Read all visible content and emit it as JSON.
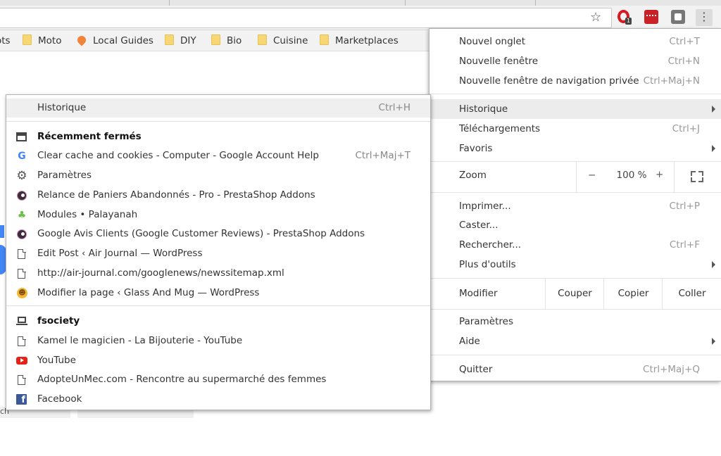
{
  "browser": {
    "toolbar": {
      "opera_badge": "1",
      "menu_glyph": "⋮"
    },
    "bookmarks": [
      {
        "label": "ots",
        "icon": "folder-icon"
      },
      {
        "label": "Moto",
        "icon": "folder-icon"
      },
      {
        "label": "Local Guides",
        "icon": "pin-icon"
      },
      {
        "label": "DIY",
        "icon": "folder-icon"
      },
      {
        "label": "Bio",
        "icon": "folder-icon"
      },
      {
        "label": "Cuisine",
        "icon": "folder-icon"
      },
      {
        "label": "Marketplaces",
        "icon": "folder-icon"
      }
    ],
    "bg_field_text": "ch"
  },
  "history_menu": {
    "header": {
      "label": "Historique",
      "shortcut": "Ctrl+H"
    },
    "recently_closed_title": "Récemment fermés",
    "recent": [
      {
        "label": "Clear cache and cookies - Computer - Google Account Help",
        "shortcut": "Ctrl+Maj+T",
        "icon": "google-icon"
      },
      {
        "label": "Paramètres",
        "icon": "gear-icon"
      },
      {
        "label": "Relance de Paniers Abandonnés - Pro - PrestaShop Addons",
        "icon": "prestashop-icon"
      },
      {
        "label": "Modules • Palayanah",
        "icon": "leaf-icon"
      },
      {
        "label": "Google Avis Clients (Google Customer Reviews) - PrestaShop Addons",
        "icon": "prestashop-icon"
      },
      {
        "label": "Edit Post ‹ Air Journal — WordPress",
        "icon": "file-icon"
      },
      {
        "label": "http://air-journal.com/googlenews/newssitemap.xml",
        "icon": "file-icon"
      },
      {
        "label": "Modifier la page ‹ Glass And Mug — WordPress",
        "icon": "smiley-icon"
      }
    ],
    "device_title": "fsociety",
    "device_tabs": [
      {
        "label": "Kamel le magicien - La Bijouterie - YouTube",
        "icon": "file-icon"
      },
      {
        "label": "YouTube",
        "icon": "youtube-icon"
      },
      {
        "label": "AdopteUnMec.com - Rencontre au supermarché des femmes",
        "icon": "file-icon"
      },
      {
        "label": "Facebook",
        "icon": "facebook-icon"
      }
    ]
  },
  "main_menu": {
    "new_tab": {
      "label": "Nouvel onglet",
      "shortcut": "Ctrl+T"
    },
    "new_window": {
      "label": "Nouvelle fenêtre",
      "shortcut": "Ctrl+N"
    },
    "incognito": {
      "label": "Nouvelle fenêtre de navigation privée",
      "shortcut": "Ctrl+Maj+N"
    },
    "history": {
      "label": "Historique"
    },
    "downloads": {
      "label": "Téléchargements",
      "shortcut": "Ctrl+J"
    },
    "bookmarks": {
      "label": "Favoris"
    },
    "zoom": {
      "label": "Zoom",
      "minus": "−",
      "value": "100 %",
      "plus": "+"
    },
    "print": {
      "label": "Imprimer...",
      "shortcut": "Ctrl+P"
    },
    "cast": {
      "label": "Caster..."
    },
    "find": {
      "label": "Rechercher...",
      "shortcut": "Ctrl+F"
    },
    "more_tools": {
      "label": "Plus d'outils"
    },
    "edit": {
      "label": "Modifier",
      "cut": "Couper",
      "copy": "Copier",
      "paste": "Coller"
    },
    "settings": {
      "label": "Paramètres"
    },
    "help": {
      "label": "Aide"
    },
    "quit": {
      "label": "Quitter",
      "shortcut": "Ctrl+Maj+Q"
    }
  },
  "colors": {
    "accent": "#4285f4",
    "highlight": "#ececec",
    "youtube": "#e62117",
    "facebook": "#3b5998"
  }
}
